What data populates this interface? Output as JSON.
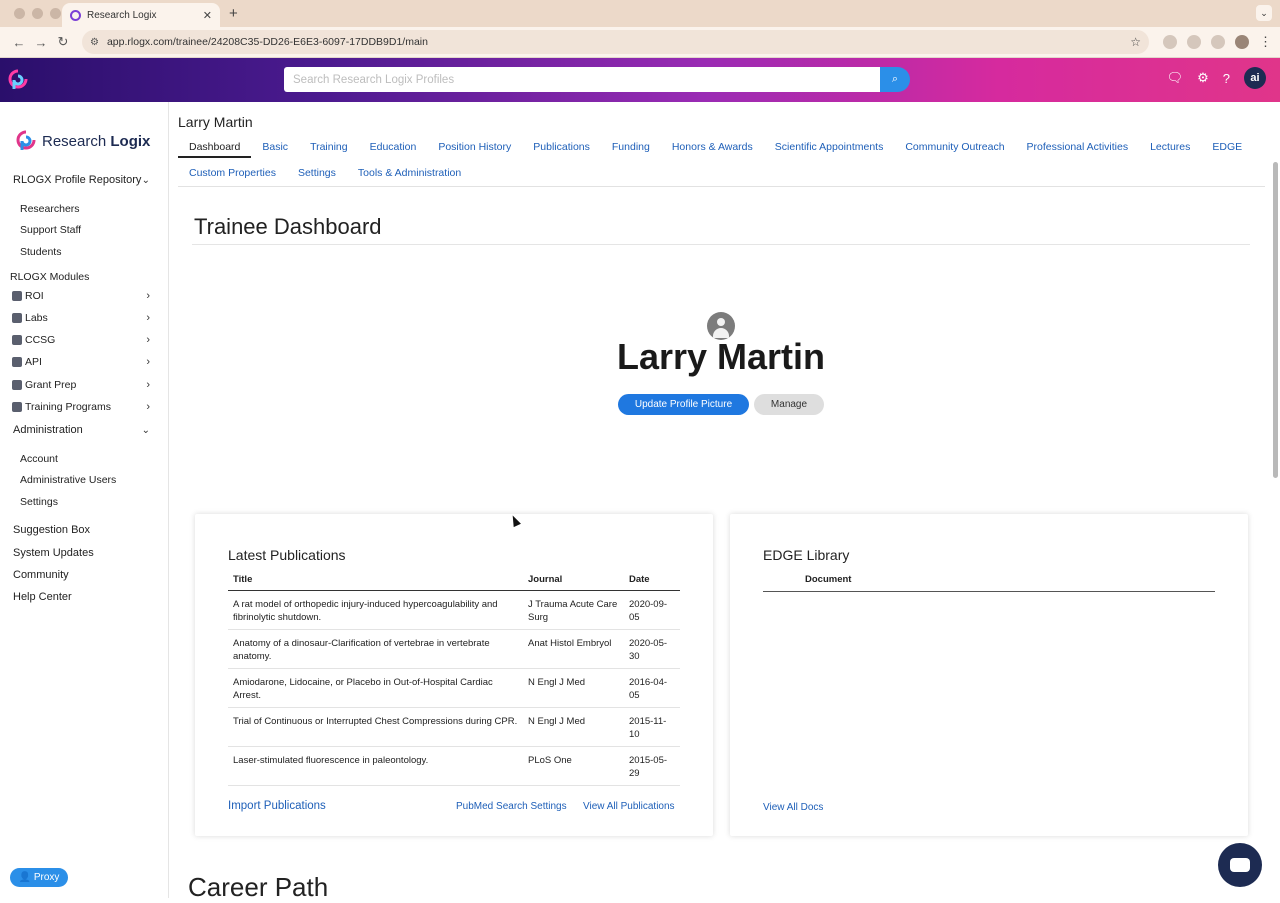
{
  "browser": {
    "tab_title": "Research Logix",
    "url": "app.rlogx.com/trainee/24208C35-DD26-E6E3-6097-17DDB9D1/main"
  },
  "header": {
    "search_placeholder": "Search Research Logix Profiles",
    "ai_label": "ai"
  },
  "sidebar": {
    "brand_left": "Research ",
    "brand_right": "Logix",
    "repository": "RLOGX Profile Repository",
    "repository_items": [
      "Researchers",
      "Support Staff",
      "Students"
    ],
    "modules_heading": "RLOGX Modules",
    "modules": [
      "ROI",
      "Labs",
      "CCSG",
      "API",
      "Grant Prep",
      "Training Programs"
    ],
    "administration": "Administration",
    "admin_items": [
      "Account",
      "Administrative Users",
      "Settings"
    ],
    "links": [
      "Suggestion Box",
      "System Updates",
      "Community",
      "Help Center"
    ],
    "proxy": "Proxy"
  },
  "profile": {
    "name": "Larry Martin",
    "tabs_row1": [
      "Dashboard",
      "Basic",
      "Training",
      "Education",
      "Position History",
      "Publications",
      "Funding",
      "Honors & Awards",
      "Scientific Appointments",
      "Community Outreach",
      "Professional Activities",
      "Lectures",
      "EDGE"
    ],
    "tabs_row2": [
      "Custom Properties",
      "Settings",
      "Tools & Administration"
    ]
  },
  "dashboard": {
    "title": "Trainee Dashboard",
    "display_name": "Larry Martin",
    "update_picture": "Update Profile Picture",
    "manage": "Manage"
  },
  "publications": {
    "title": "Latest Publications",
    "columns": [
      "Title",
      "Journal",
      "Date"
    ],
    "rows": [
      {
        "title": "A rat model of orthopedic injury-induced hypercoagulability and fibrinolytic shutdown.",
        "journal": "J Trauma Acute Care Surg",
        "date": "2020-09-05"
      },
      {
        "title": "Anatomy of a dinosaur-Clarification of vertebrae in vertebrate anatomy.",
        "journal": "Anat Histol Embryol",
        "date": "2020-05-30"
      },
      {
        "title": "Amiodarone, Lidocaine, or Placebo in Out-of-Hospital Cardiac Arrest.",
        "journal": "N Engl J Med",
        "date": "2016-04-05"
      },
      {
        "title": "Trial of Continuous or Interrupted Chest Compressions during CPR.",
        "journal": "N Engl J Med",
        "date": "2015-11-10"
      },
      {
        "title": "Laser-stimulated fluorescence in paleontology.",
        "journal": "PLoS One",
        "date": "2015-05-29"
      }
    ],
    "import_link": "Import Publications",
    "pubmed_link": "PubMed Search Settings",
    "view_all_link": "View All Publications"
  },
  "edge": {
    "title": "EDGE Library",
    "column": "Document",
    "view_all_link": "View All Docs"
  },
  "career": {
    "title": "Career Path"
  },
  "colors": {
    "accent": "#1f78e0",
    "link": "#1e5fb8",
    "navy": "#1d2b52"
  }
}
